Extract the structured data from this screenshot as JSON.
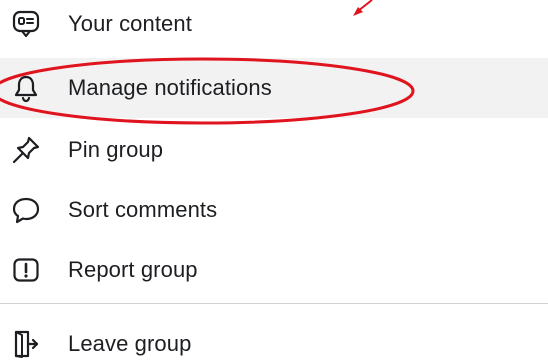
{
  "menu": {
    "items": [
      {
        "label": "Your content",
        "icon": "chat-bubble-text-icon"
      },
      {
        "label": "Manage notifications",
        "icon": "bell-icon"
      },
      {
        "label": "Pin group",
        "icon": "pushpin-icon"
      },
      {
        "label": "Sort comments",
        "icon": "comment-bubble-icon"
      },
      {
        "label": "Report group",
        "icon": "report-exclamation-icon"
      },
      {
        "label": "Leave group",
        "icon": "exit-door-icon"
      }
    ]
  },
  "annotation": {
    "color": "#e0141e",
    "highlighted_item": "Manage notifications"
  },
  "colors": {
    "text": "#1c1e21",
    "highlight_bg": "#f2f2f2",
    "divider": "#d0d3d6"
  }
}
